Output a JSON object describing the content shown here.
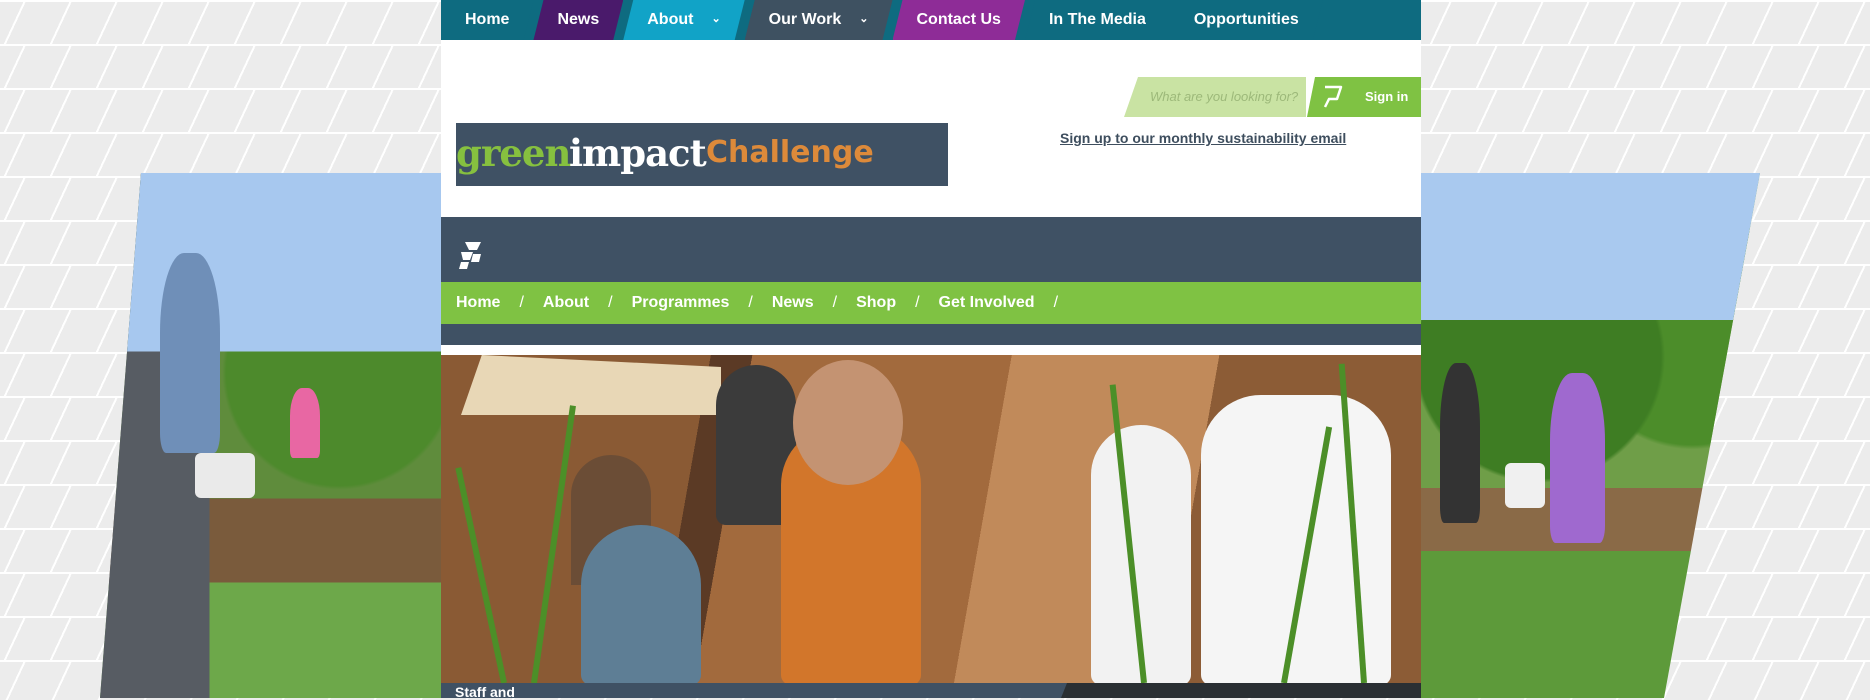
{
  "topnav": {
    "items": [
      {
        "label": "Home",
        "color": "#0e6b80",
        "dropdown": false
      },
      {
        "label": "News",
        "color": "#4a1a6b",
        "dropdown": false
      },
      {
        "label": "About",
        "color": "#11a3c7",
        "dropdown": true
      },
      {
        "label": "Our Work",
        "color": "#3e5161",
        "dropdown": true
      },
      {
        "label": "Contact Us",
        "color": "#8e2c97",
        "dropdown": false
      },
      {
        "label": "In The Media",
        "color": "#0e6b80",
        "dropdown": false
      },
      {
        "label": "Opportunities",
        "color": "#0e6b80",
        "dropdown": false
      }
    ],
    "chevron": "⌄"
  },
  "search": {
    "placeholder": "What are you looking for?"
  },
  "signin": {
    "label": "Sign in"
  },
  "logo": {
    "word_green": "green",
    "word_impact": "impact",
    "word_challenge": "Challenge"
  },
  "signup": {
    "text": "Sign up to our monthly sustainability email"
  },
  "breadcrumb": {
    "items": [
      "Home",
      "About",
      "Programmes",
      "News",
      "Shop",
      "Get Involved"
    ],
    "separator": "/"
  },
  "bottom": {
    "label": "Staff and"
  },
  "colors": {
    "brand_dark": "#3f5164",
    "brand_green": "#7fc243",
    "accent_orange": "#dd8a3a"
  }
}
